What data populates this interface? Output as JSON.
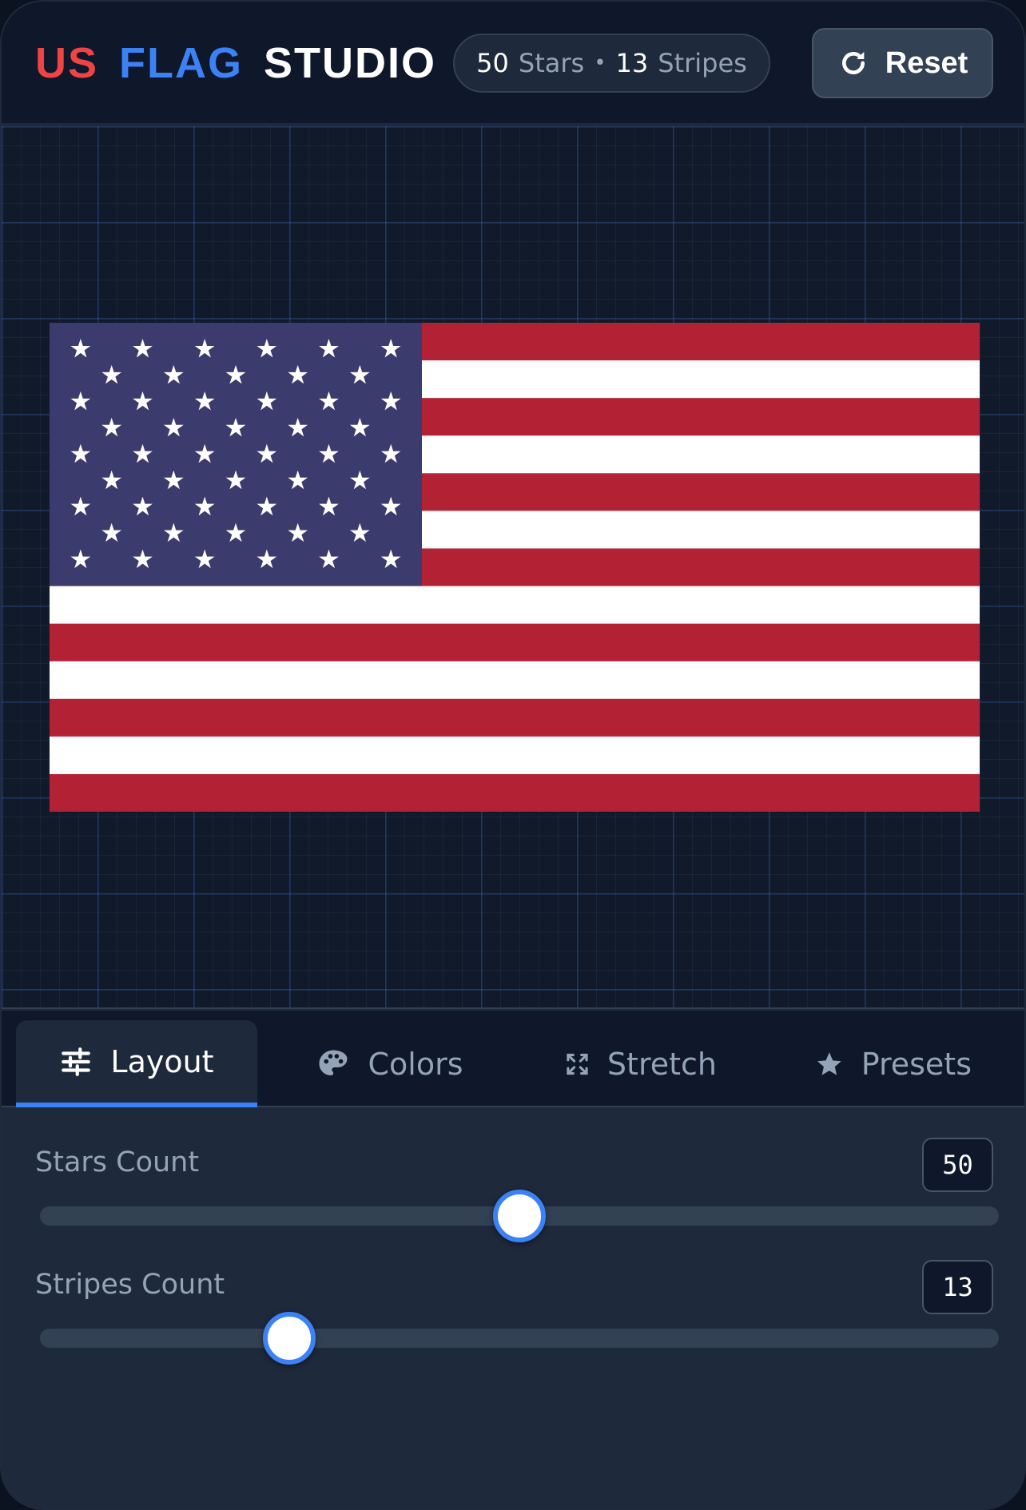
{
  "brand": {
    "word1": "US",
    "word2": "FLAG",
    "word3": "STUDIO"
  },
  "stats": {
    "stars_value": "50",
    "stars_label": "Stars",
    "separator": "•",
    "stripes_value": "13",
    "stripes_label": "Stripes"
  },
  "reset": {
    "label": "Reset",
    "icon": "refresh-icon"
  },
  "flag": {
    "stars": 50,
    "stripes": 13,
    "colors": {
      "red": "#b22234",
      "white": "#ffffff",
      "blue": "#3c3b6e"
    }
  },
  "tabs": [
    {
      "label": "Layout",
      "icon": "sliders-icon",
      "active": true
    },
    {
      "label": "Colors",
      "icon": "palette-icon",
      "active": false
    },
    {
      "label": "Stretch",
      "icon": "expand-icon",
      "active": false
    },
    {
      "label": "Presets",
      "icon": "star-icon",
      "active": false
    }
  ],
  "controls": {
    "stars": {
      "label": "Stars Count",
      "value": "50",
      "fraction": 0.5
    },
    "stripes": {
      "label": "Stripes Count",
      "value": "13",
      "fraction": 0.26
    }
  },
  "theme": {
    "accent": "#3b82f6",
    "brand_red": "#ef4444",
    "background": "#0f172a",
    "panel": "#1e293b"
  }
}
